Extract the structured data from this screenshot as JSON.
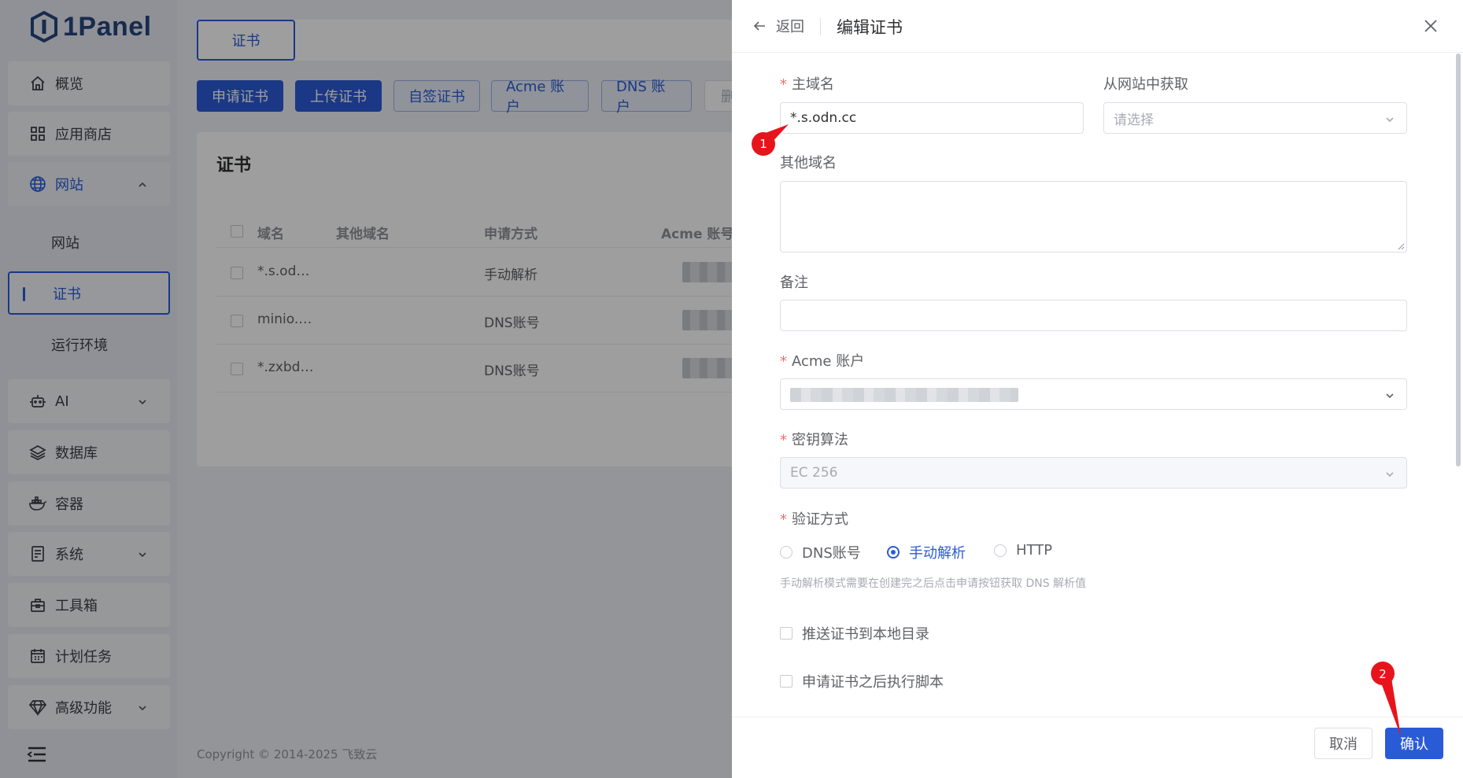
{
  "app": {
    "logo_text": "1Panel"
  },
  "sidebar": {
    "items": [
      {
        "label": "概览",
        "icon": "home-icon"
      },
      {
        "label": "应用商店",
        "icon": "grid-icon"
      },
      {
        "label": "网站",
        "icon": "globe-icon"
      },
      {
        "label": "AI",
        "icon": "robot-icon"
      },
      {
        "label": "数据库",
        "icon": "layers-icon"
      },
      {
        "label": "容器",
        "icon": "docker-icon"
      },
      {
        "label": "系统",
        "icon": "server-icon"
      },
      {
        "label": "工具箱",
        "icon": "toolbox-icon"
      },
      {
        "label": "计划任务",
        "icon": "calendar-icon"
      },
      {
        "label": "高级功能",
        "icon": "diamond-icon"
      }
    ],
    "sub_items": [
      {
        "label": "网站"
      },
      {
        "label": "证书"
      },
      {
        "label": "运行环境"
      }
    ]
  },
  "main": {
    "tab": "证书",
    "toolbar": {
      "apply": "申请证书",
      "upload": "上传证书",
      "self_signed": "自签证书",
      "acme": "Acme 账户",
      "dns": "DNS 账户",
      "delete": "删"
    },
    "card_title": "证书",
    "columns": [
      "域名",
      "其他域名",
      "申请方式",
      "Acme 账号"
    ],
    "rows": [
      {
        "domain": "*.s.od…",
        "method": "手动解析"
      },
      {
        "domain": "minio.…",
        "method": "DNS账号"
      },
      {
        "domain": "*.zxbd…",
        "method": "DNS账号"
      }
    ],
    "footer": "Copyright © 2014-2025 飞致云"
  },
  "drawer": {
    "back_label": "返回",
    "title": "编辑证书",
    "primary_domain": {
      "label": "主域名",
      "value": "*.s.odn.cc"
    },
    "from_site": {
      "label": "从网站中获取",
      "placeholder": "请选择"
    },
    "other_domains": {
      "label": "其他域名"
    },
    "remark": {
      "label": "备注"
    },
    "acme_account": {
      "label": "Acme 账户"
    },
    "key_algorithm": {
      "label": "密钥算法",
      "value": "EC 256"
    },
    "verify_method": {
      "label": "验证方式",
      "options": [
        "DNS账号",
        "手动解析",
        "HTTP"
      ],
      "selected": "手动解析",
      "hint": "手动解析模式需要在创建完之后点击申请按钮获取 DNS 解析值"
    },
    "push_local": "推送证书到本地目录",
    "exec_script": "申请证书之后执行脚本",
    "cancel_label": "取消",
    "confirm_label": "确认"
  },
  "annotations": {
    "marker1": "1",
    "marker2": "2"
  },
  "colors": {
    "primary": "#2a5bd7",
    "danger_marker": "#e8141c",
    "required": "#f56c6c"
  }
}
